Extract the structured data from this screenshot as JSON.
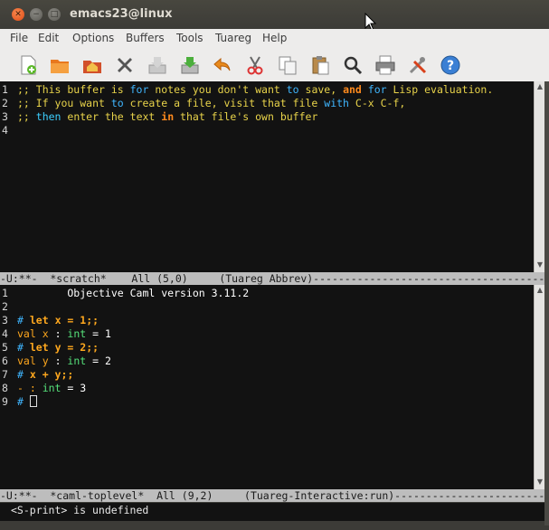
{
  "window": {
    "title": "emacs23@linux"
  },
  "menubar": [
    "File",
    "Edit",
    "Options",
    "Buffers",
    "Tools",
    "Tuareg",
    "Help"
  ],
  "toolbar_icons": [
    "new-file-icon",
    "open-folder-icon",
    "dired-icon",
    "close-buffer-icon",
    "save-icon",
    "save-as-icon",
    "undo-icon",
    "cut-icon",
    "copy-icon",
    "paste-icon",
    "search-icon",
    "print-icon",
    "customize-icon",
    "help-icon"
  ],
  "scratch": {
    "lines": [
      {
        "num": "1",
        "segments": [
          {
            "t": ";; This buffer is ",
            "c": "cm"
          },
          {
            "t": "for",
            "c": "cmk"
          },
          {
            "t": " notes you don't want ",
            "c": "cm"
          },
          {
            "t": "to",
            "c": "cmk"
          },
          {
            "t": " save, ",
            "c": "cm"
          },
          {
            "t": "and",
            "c": "cmk2"
          },
          {
            "t": " ",
            "c": "cm"
          },
          {
            "t": "for",
            "c": "cmk"
          },
          {
            "t": " Lisp evaluation.",
            "c": "cm"
          }
        ]
      },
      {
        "num": "2",
        "segments": [
          {
            "t": ";; If you want ",
            "c": "cm"
          },
          {
            "t": "to",
            "c": "cmk"
          },
          {
            "t": " create a file, visit that file ",
            "c": "cm"
          },
          {
            "t": "with",
            "c": "cmk"
          },
          {
            "t": " C-x C-f,",
            "c": "cm"
          }
        ]
      },
      {
        "num": "3",
        "segments": [
          {
            "t": ";; ",
            "c": "cm"
          },
          {
            "t": "then",
            "c": "cmk3"
          },
          {
            "t": " enter the text ",
            "c": "cm"
          },
          {
            "t": "in",
            "c": "cmk2"
          },
          {
            "t": " that file's own buffer",
            "c": "cm"
          }
        ]
      },
      {
        "num": "4",
        "segments": []
      }
    ],
    "modeline": "-U:**-  *scratch*    All (5,0)     (Tuareg Abbrev)-------------------------------------"
  },
  "toplevel": {
    "lines": [
      {
        "num": "1",
        "segments": [
          {
            "t": "        Objective Caml version 3.11.2",
            "c": "nm"
          }
        ]
      },
      {
        "num": "2",
        "segments": []
      },
      {
        "num": "3",
        "segments": [
          {
            "t": "#",
            "c": "prompt"
          },
          {
            "t": " ",
            "c": "nm"
          },
          {
            "t": "let",
            "c": "kw"
          },
          {
            "t": " x = 1;;",
            "c": "kw"
          }
        ]
      },
      {
        "num": "4",
        "segments": [
          {
            "t": "val",
            "c": "vl"
          },
          {
            "t": " x ",
            "c": "vl"
          },
          {
            "t": ":",
            "c": "nm"
          },
          {
            "t": " int",
            "c": "ty"
          },
          {
            "t": " = 1",
            "c": "nm"
          }
        ]
      },
      {
        "num": "5",
        "segments": [
          {
            "t": "#",
            "c": "prompt"
          },
          {
            "t": " ",
            "c": "nm"
          },
          {
            "t": "let",
            "c": "kw"
          },
          {
            "t": " y = 2;;",
            "c": "kw"
          }
        ]
      },
      {
        "num": "6",
        "segments": [
          {
            "t": "val",
            "c": "vl"
          },
          {
            "t": " y ",
            "c": "vl"
          },
          {
            "t": ":",
            "c": "nm"
          },
          {
            "t": " int",
            "c": "ty"
          },
          {
            "t": " = 2",
            "c": "nm"
          }
        ]
      },
      {
        "num": "7",
        "segments": [
          {
            "t": "#",
            "c": "prompt"
          },
          {
            "t": " x + y;;",
            "c": "kw"
          }
        ]
      },
      {
        "num": "8",
        "segments": [
          {
            "t": "- : ",
            "c": "vl"
          },
          {
            "t": "int",
            "c": "ty"
          },
          {
            "t": " = 3",
            "c": "nm"
          }
        ]
      },
      {
        "num": "9",
        "segments": [
          {
            "t": "#",
            "c": "prompt"
          },
          {
            "t": " ",
            "c": "nm"
          }
        ],
        "cursor": true
      }
    ],
    "modeline": "-U:**-  *caml-toplevel*  All (9,2)     (Tuareg-Interactive:run)------------------------"
  },
  "minibuffer": "<S-print> is undefined"
}
